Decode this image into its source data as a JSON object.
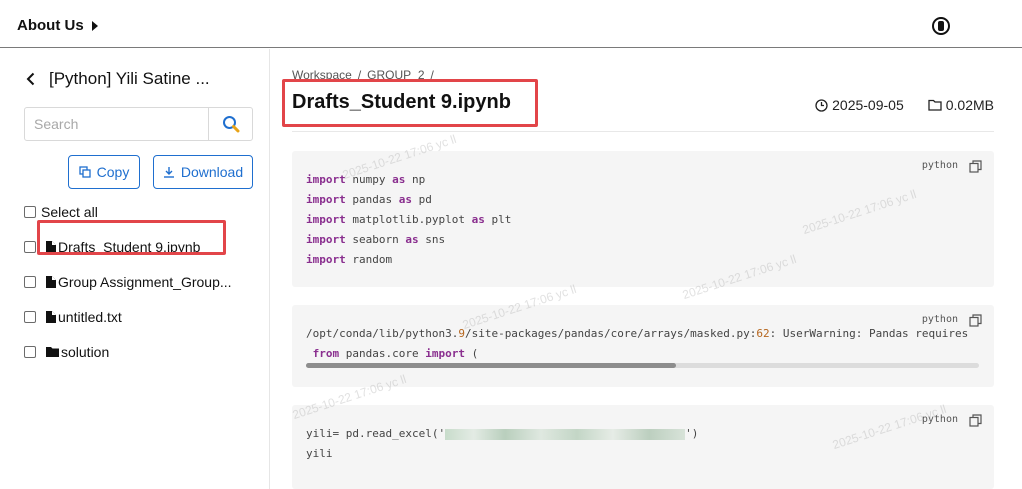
{
  "header": {
    "about_label": "About Us"
  },
  "sidebar": {
    "back_title": "[Python] Yili Satine ...",
    "search_placeholder": "Search",
    "copy_label": "Copy",
    "download_label": "Download",
    "select_all_label": "Select all",
    "files": [
      {
        "name": "Drafts_Student 9.ipynb",
        "type": "file",
        "highlighted": true
      },
      {
        "name": "Group Assignment_Group...",
        "type": "file"
      },
      {
        "name": "untitled.txt",
        "type": "file"
      },
      {
        "name": "solution",
        "type": "folder"
      }
    ]
  },
  "main": {
    "breadcrumb": [
      "Workspace",
      "GROUP_2"
    ],
    "breadcrumb_separator": "/",
    "title": "Drafts_Student 9.ipynb",
    "date": "2025-09-05",
    "size": "0.02MB",
    "code_blocks": [
      {
        "lang": "python",
        "lines": [
          [
            {
              "kw": "import"
            },
            {
              "t": " numpy "
            },
            {
              "kw": "as"
            },
            {
              "t": " np"
            }
          ],
          [
            {
              "kw": "import"
            },
            {
              "t": " pandas "
            },
            {
              "kw": "as"
            },
            {
              "t": " pd"
            }
          ],
          [
            {
              "kw": "import"
            },
            {
              "t": " matplotlib.pyplot "
            },
            {
              "kw": "as"
            },
            {
              "t": " plt"
            }
          ],
          [
            {
              "kw": "import"
            },
            {
              "t": " seaborn "
            },
            {
              "kw": "as"
            },
            {
              "t": " sns"
            }
          ],
          [
            {
              "kw": "import"
            },
            {
              "t": " random"
            }
          ]
        ]
      },
      {
        "lang": "python",
        "lines": [
          [
            {
              "t": "/opt/conda/lib/python3."
            },
            {
              "num": "9"
            },
            {
              "t": "/site-packages/pandas/core/arrays/masked.py:"
            },
            {
              "num": "62"
            },
            {
              "t": ": UserWarning: Pandas requires"
            }
          ],
          [
            {
              "t": " "
            },
            {
              "kw": "from"
            },
            {
              "t": " pandas.core "
            },
            {
              "kw": "import"
            },
            {
              "t": " ("
            }
          ]
        ],
        "scroll_fraction": 0.55
      },
      {
        "lang": "python",
        "lines": [
          [
            {
              "t": "yili= pd.read_excel('"
            },
            {
              "blur": true
            },
            {
              "t": "')"
            }
          ],
          [
            {
              "t": "yili"
            }
          ]
        ]
      }
    ]
  },
  "watermark": "2025-10-22 17:06 yc ll",
  "colors": {
    "accent": "#1f6fcf",
    "highlight": "#e24549",
    "keyword": "#8a2f8f",
    "code_bg": "#f5f5f5"
  }
}
